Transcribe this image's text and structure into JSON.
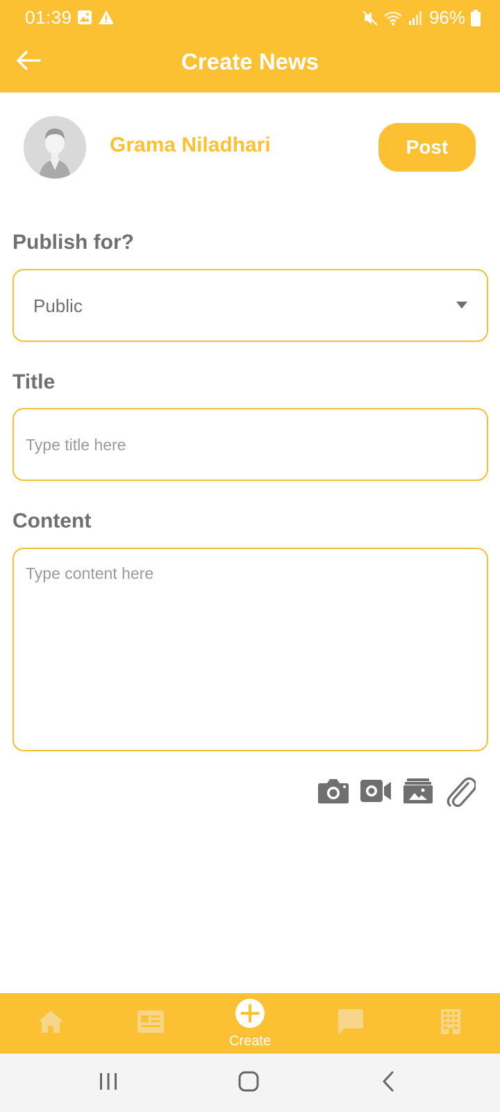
{
  "status_bar": {
    "time": "01:39",
    "battery": "96%",
    "left_icons": [
      "image-icon",
      "warning-icon"
    ],
    "right_icons": [
      "mute-icon",
      "wifi-icon",
      "signal-icon",
      "battery-icon"
    ]
  },
  "header": {
    "title": "Create News",
    "back_icon": "arrow-left-icon"
  },
  "author": {
    "name": "Grama Niladhari",
    "post_label": "Post"
  },
  "form": {
    "publish_label": "Publish for?",
    "publish_value": "Public",
    "title_label": "Title",
    "title_placeholder": "Type title here",
    "content_label": "Content",
    "content_placeholder": "Type content here"
  },
  "attachments": [
    "camera-icon",
    "video-icon",
    "gallery-icon",
    "paperclip-icon"
  ],
  "bottom_nav": {
    "items": [
      {
        "icon": "home-icon"
      },
      {
        "icon": "news-icon"
      },
      {
        "icon": "create-icon",
        "label": "Create"
      },
      {
        "icon": "chat-icon"
      },
      {
        "icon": "building-icon"
      }
    ]
  },
  "colors": {
    "accent": "#FBC133",
    "text_gray": "#6f6f6f",
    "placeholder_gray": "#9a9a9a",
    "nav_icon_faded": "#F6D68A"
  }
}
